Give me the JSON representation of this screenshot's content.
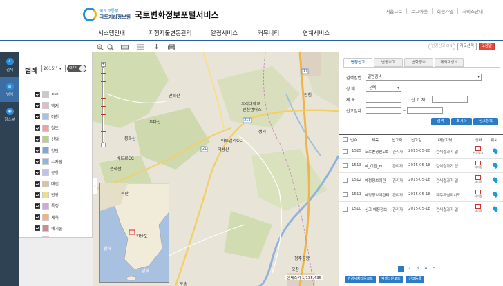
{
  "header": {
    "org_line1": "국토교통부",
    "org_line2": "국토지리정보원",
    "site_title": "국토변화정보포털서비스",
    "utility_links": [
      "처음으로",
      "로그아웃",
      "회원가입",
      "서비스안내"
    ],
    "nav": [
      "시스템안내",
      "지형지물변동관리",
      "알림서비스",
      "커뮤니티",
      "연계서비스"
    ]
  },
  "rail": [
    {
      "label": "검색",
      "icon": "search-icon"
    },
    {
      "label": "범례",
      "icon": "list-icon"
    },
    {
      "label": "항스뷰",
      "icon": "globe-icon"
    }
  ],
  "toolbar": {
    "tools": [
      "zoom-in-icon",
      "zoom-out-icon",
      "measure-distance-icon",
      "measure-area-icon",
      "download-icon",
      "print-icon"
    ],
    "change_report": "변경신고 ON",
    "map_select": "지도선택",
    "logout": "도움말"
  },
  "legend": {
    "title": "범례",
    "year": "2015년",
    "toggle": "OFF",
    "layers": [
      {
        "label": "도로",
        "color": "#c9c9c9"
      },
      {
        "label": "댁지",
        "color": "#e7b6cf"
      },
      {
        "label": "하천",
        "color": "#9fc4ea"
      },
      {
        "label": "철도",
        "color": "#f2a0a0"
      },
      {
        "label": "산업",
        "color": "#b7d27e"
      },
      {
        "label": "항만",
        "color": "#7fa7d6"
      },
      {
        "label": "수자원",
        "color": "#86b9e8"
      },
      {
        "label": "공항",
        "color": "#c0c0ea"
      },
      {
        "label": "매립",
        "color": "#d7c4a1"
      },
      {
        "label": "관광",
        "color": "#f0df7a"
      },
      {
        "label": "특정",
        "color": "#d3a6e3"
      },
      {
        "label": "체육",
        "color": "#f3b27f"
      },
      {
        "label": "폐기물",
        "color": "#cf8b8b"
      },
      {
        "label": "주기",
        "color": "#a8d4d0"
      }
    ]
  },
  "map": {
    "labels": [
      "진천",
      "만뢰산",
      "우석대학교",
      "진천캠퍼스",
      "두타산",
      "봉화산",
      "아트밸리CC",
      "덕용산",
      "생거",
      "베드로CC",
      "은적산",
      "북한",
      "한반도",
      "황해",
      "남해",
      "동해",
      "청주공항",
      "오창",
      "오송"
    ],
    "roads": [
      "313",
      "21",
      "17",
      "34"
    ],
    "scale": "현재축척 1/135,435",
    "zoom_plus": "+",
    "zoom_minus": "−",
    "collapse_arrow": "‹"
  },
  "panel": {
    "tabs": [
      "변경신고",
      "변동보고",
      "변화정보",
      "제외대상소"
    ],
    "form": {
      "search_method_label": "검색방법",
      "search_method_value": "일반검색",
      "state_label": "상 태",
      "state_value": "-선택-",
      "title_label": "제 목",
      "reporter_label": "신 고 자",
      "date_label": "신고일자",
      "date_sep": "~",
      "btn_search": "검색",
      "btn_reset": "초기화",
      "btn_register": "신고등록"
    },
    "list": {
      "headers": [
        "번호",
        "제목",
        "신고자",
        "신고일",
        "대상지역",
        "상태",
        "위치"
      ],
      "rows": [
        {
          "no": "1525",
          "title": "도로변경신고0",
          "reporter": "관리자",
          "date": "2015-05-20",
          "region": "검색결과가 없",
          "state": "변동보고"
        },
        {
          "no": "1513",
          "title": "예_이관_ol",
          "reporter": "관리자",
          "date": "2015-05-18",
          "region": "검색결과가 없",
          "state": "처리중"
        },
        {
          "no": "1512",
          "title": "예정정보이관",
          "reporter": "관리자",
          "date": "2015-05-18",
          "region": "검색결과가 없",
          "state": "처리중"
        },
        {
          "no": "1511",
          "title": "예정정보이관테",
          "reporter": "관리자",
          "date": "2015-05-18",
          "region": "제주특별자치도",
          "state": "처리중"
        },
        {
          "no": "1510",
          "title": "신고 예정정보",
          "reporter": "관리자",
          "date": "2015-05-18",
          "region": "검색결과가 없",
          "state": "처리중"
        }
      ]
    },
    "pages": [
      "1",
      "2",
      "3",
      "4",
      "5"
    ],
    "bottom_buttons": [
      "변경사항다운로드",
      "엑셀다운로드",
      "신고등록"
    ]
  }
}
